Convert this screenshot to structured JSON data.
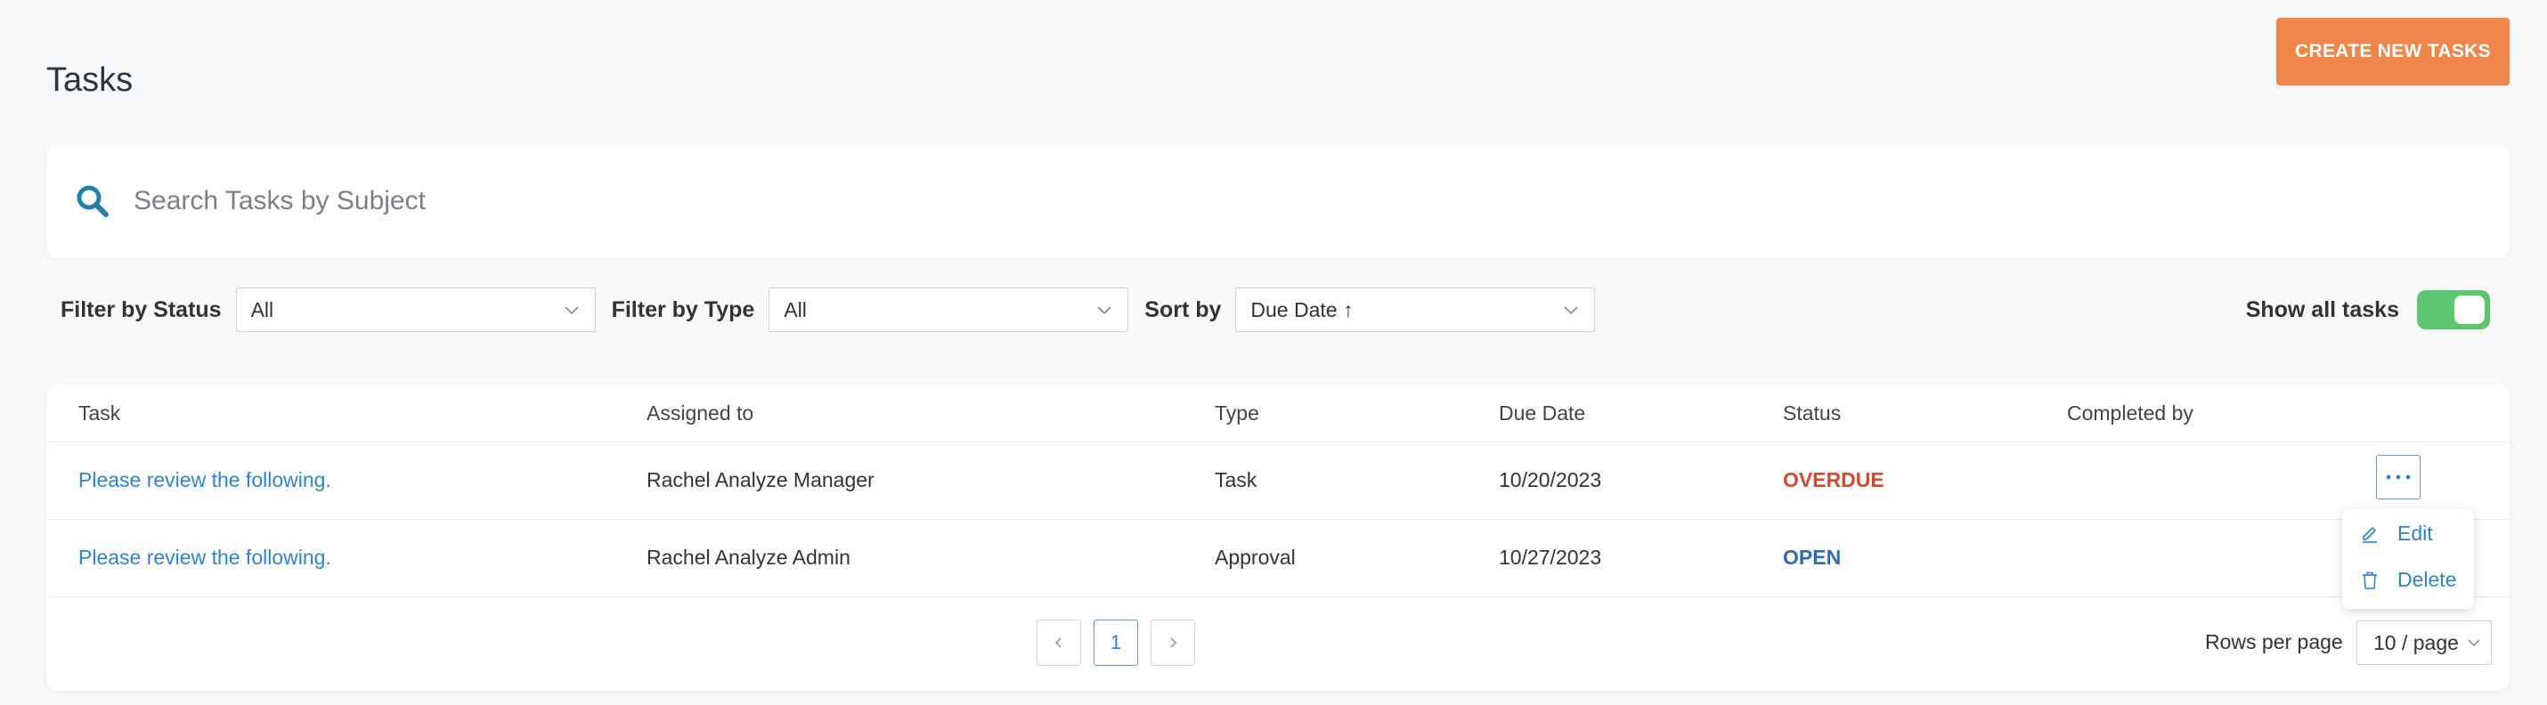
{
  "header": {
    "title": "Tasks",
    "create_button_label": "CREATE NEW TASKS"
  },
  "search": {
    "placeholder": "Search Tasks by Subject",
    "value": ""
  },
  "filters": {
    "status_label": "Filter by Status",
    "status_value": "All",
    "type_label": "Filter by Type",
    "type_value": "All",
    "sort_label": "Sort by",
    "sort_value": "Due Date ↑",
    "show_all_label": "Show all tasks",
    "show_all_enabled": true
  },
  "table": {
    "columns": [
      "Task",
      "Assigned to",
      "Type",
      "Due Date",
      "Status",
      "Completed by"
    ],
    "rows": [
      {
        "task": "Please review the following.",
        "assigned_to": "Rachel Analyze Manager",
        "type": "Task",
        "due_date": "10/20/2023",
        "status": "OVERDUE",
        "completed_by": ""
      },
      {
        "task": "Please review the following.",
        "assigned_to": "Rachel Analyze Admin",
        "type": "Approval",
        "due_date": "10/27/2023",
        "status": "OPEN",
        "completed_by": ""
      }
    ]
  },
  "row_menu": {
    "edit_label": "Edit",
    "delete_label": "Delete"
  },
  "pagination": {
    "current_page": "1",
    "rows_per_page_label": "Rows per page",
    "rows_per_page_value": "10 / page"
  },
  "colors": {
    "accent": "#f0874a",
    "link": "#2b83d4",
    "overdue": "#d04b2f",
    "open": "#2f6cb5",
    "toggle_on": "#5cc66e"
  }
}
